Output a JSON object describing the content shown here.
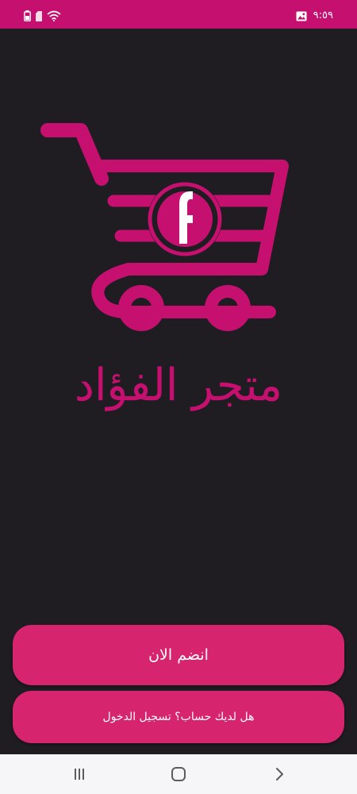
{
  "colors": {
    "brand": "#c5106f",
    "button": "#d6246e",
    "background": "#1f1d22",
    "nav_bar": "#f6f6f8"
  },
  "status_bar": {
    "time": "٩:٥٩",
    "icons": [
      "battery-icon",
      "sim-icon",
      "wifi-icon",
      "image-notification-icon"
    ]
  },
  "store": {
    "name": "متجر الفؤاد",
    "logo_letter": "f"
  },
  "actions": {
    "join_label": "انضم الان",
    "login_label": "هل لديك حساب؟ تسجيل الدخول"
  },
  "nav_bar": {
    "icons": [
      "recent-apps-icon",
      "home-icon",
      "back-icon"
    ]
  }
}
